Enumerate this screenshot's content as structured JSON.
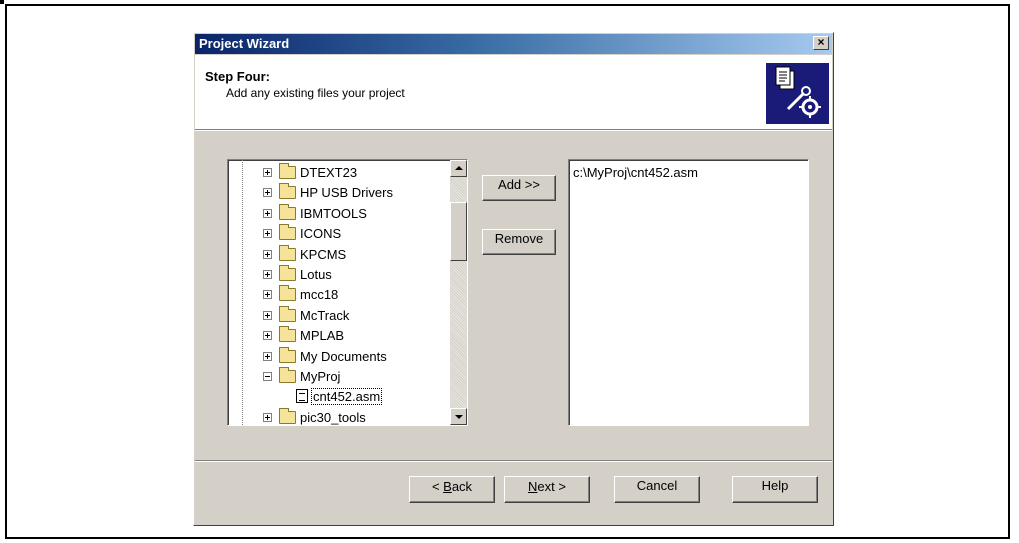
{
  "dialog": {
    "title": "Project Wizard",
    "close_label": "×"
  },
  "header": {
    "step_title": "Step Four:",
    "step_description": "Add any existing files your project"
  },
  "tree": {
    "items": [
      {
        "label": "DTEXT23",
        "type": "folder",
        "expanded": false
      },
      {
        "label": "HP USB Drivers",
        "type": "folder",
        "expanded": false
      },
      {
        "label": "IBMTOOLS",
        "type": "folder",
        "expanded": false
      },
      {
        "label": "ICONS",
        "type": "folder",
        "expanded": false
      },
      {
        "label": "KPCMS",
        "type": "folder",
        "expanded": false
      },
      {
        "label": "Lotus",
        "type": "folder",
        "expanded": false
      },
      {
        "label": "mcc18",
        "type": "folder",
        "expanded": false
      },
      {
        "label": "McTrack",
        "type": "folder",
        "expanded": false
      },
      {
        "label": "MPLAB",
        "type": "folder",
        "expanded": false
      },
      {
        "label": "My Documents",
        "type": "folder",
        "expanded": false
      },
      {
        "label": "MyProj",
        "type": "folder",
        "expanded": true
      },
      {
        "label": "cnt452.asm",
        "type": "file",
        "selected": true
      },
      {
        "label": "pic30_tools",
        "type": "folder",
        "expanded": false
      }
    ]
  },
  "actions": {
    "add_label": "Add >>",
    "remove_label": "Remove"
  },
  "added_files": [
    "c:\\MyProj\\cnt452.asm"
  ],
  "footer": {
    "back_prefix": "< ",
    "back_key": "B",
    "back_rest": "ack",
    "next_key": "N",
    "next_rest": "ext >",
    "cancel_label": "Cancel",
    "help_label": "Help"
  }
}
